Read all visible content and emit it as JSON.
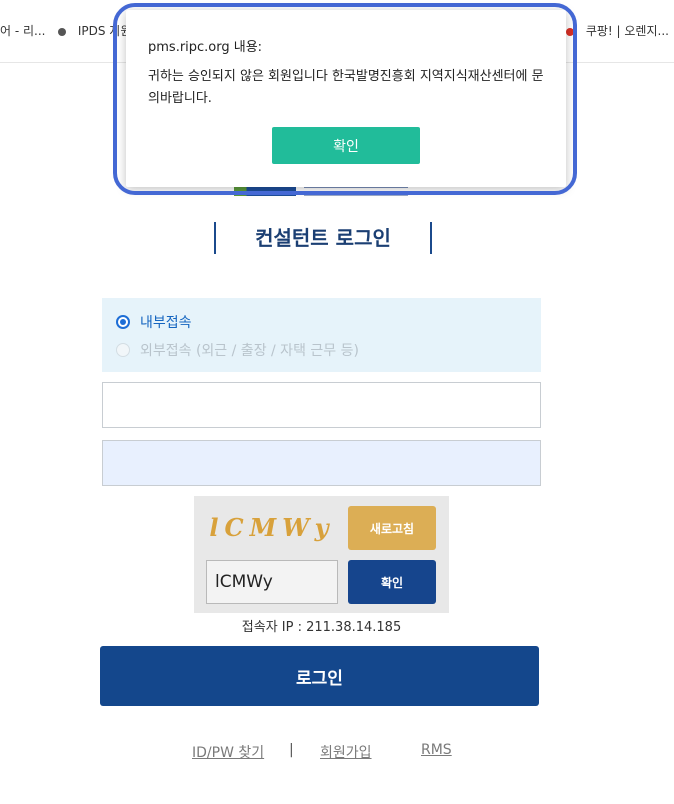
{
  "browser": {
    "bookmarks": [
      {
        "label": "어 - 리...",
        "dot": "none"
      },
      {
        "label": "IPDS 지원",
        "dot": "gray"
      },
      {
        "label": "쿠팡! | 오렌지...",
        "dot": "red"
      }
    ]
  },
  "dialog": {
    "origin": "pms.ripc.org 내용:",
    "message": "귀하는 승인되지 않은 회원입니다 한국발명진흥회 지역지식재산센터에 문의바랍니다.",
    "ok_label": "확인"
  },
  "page": {
    "title": "컨설턴트 로그인"
  },
  "access": {
    "options": [
      {
        "label": "내부접속",
        "selected": true
      },
      {
        "label": "외부접속 (외근 / 출장 / 자택 근무 등)",
        "selected": false
      }
    ]
  },
  "login": {
    "id_value": "",
    "pw_value": ""
  },
  "captcha": {
    "image_text": "lCMWy",
    "refresh_label": "새로고침",
    "input_value": "lCMWy",
    "confirm_label": "확인"
  },
  "ip_text": "접속자 IP : 211.38.14.185",
  "login_button": "로그인",
  "footer": {
    "find_label": "ID/PW 찾기",
    "separator": "|",
    "join_label": "회원가입",
    "rms_label": "RMS"
  },
  "colors": {
    "primary": "#14478c",
    "accent_refresh": "#dcae55",
    "dialog_ok": "#21bc9a",
    "highlight": "#4468d4"
  }
}
